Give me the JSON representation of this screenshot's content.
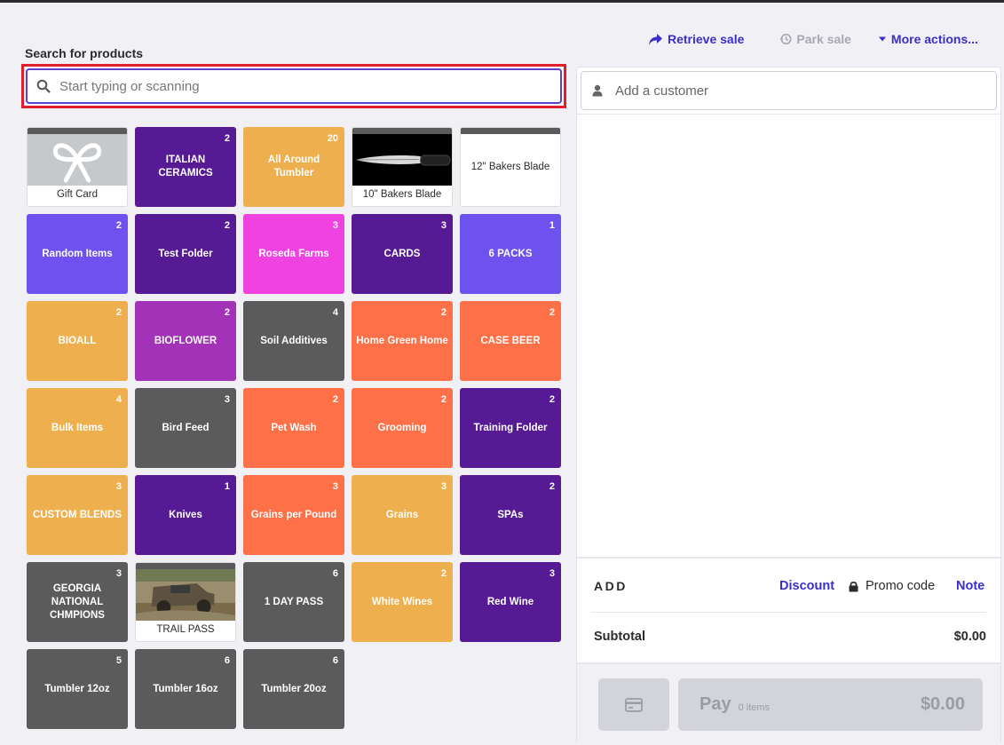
{
  "search": {
    "label": "Search for products",
    "placeholder": "Start typing or scanning"
  },
  "actions": {
    "retrieve": "Retrieve sale",
    "park": "Park sale",
    "more": "More actions..."
  },
  "tiles": [
    {
      "label": "Gift Card",
      "count": "",
      "kind": "image",
      "icon": "gift-bow-image",
      "color": "#c5c9cc"
    },
    {
      "label": "ITALIAN CERAMICS",
      "count": "2",
      "kind": "folder",
      "color": "#561a95"
    },
    {
      "label": "All Around Tumbler",
      "count": "20",
      "kind": "folder",
      "color": "#eeb04e"
    },
    {
      "label": "10\" Bakers Blade",
      "count": "",
      "kind": "image",
      "icon": "knife-image",
      "color": "#000000"
    },
    {
      "label": "12\" Bakers Blade",
      "count": "",
      "kind": "plain",
      "color": "#ffffff"
    },
    {
      "label": "Random Items",
      "count": "2",
      "kind": "folder",
      "color": "#6e52f0"
    },
    {
      "label": "Test Folder",
      "count": "2",
      "kind": "folder",
      "color": "#561a95"
    },
    {
      "label": "Roseda Farms",
      "count": "3",
      "kind": "folder",
      "color": "#f042e0"
    },
    {
      "label": "CARDS",
      "count": "3",
      "kind": "folder",
      "color": "#561a95"
    },
    {
      "label": "6 PACKS",
      "count": "1",
      "kind": "folder",
      "color": "#6e52f0"
    },
    {
      "label": "BIOALL",
      "count": "2",
      "kind": "folder",
      "color": "#eeb04e"
    },
    {
      "label": "BIOFLOWER",
      "count": "2",
      "kind": "folder",
      "color": "#a232b8"
    },
    {
      "label": "Soil Additives",
      "count": "4",
      "kind": "folder",
      "color": "#5b5b5b"
    },
    {
      "label": "Home Green Home",
      "count": "2",
      "kind": "folder",
      "color": "#fe7048"
    },
    {
      "label": "CASE BEER",
      "count": "2",
      "kind": "folder",
      "color": "#fe7048"
    },
    {
      "label": "Bulk Items",
      "count": "4",
      "kind": "folder",
      "color": "#eeb04e"
    },
    {
      "label": "Bird Feed",
      "count": "3",
      "kind": "folder",
      "color": "#5b5b5b"
    },
    {
      "label": "Pet Wash",
      "count": "2",
      "kind": "folder",
      "color": "#fe7048"
    },
    {
      "label": "Grooming",
      "count": "2",
      "kind": "folder",
      "color": "#fe7048"
    },
    {
      "label": "Training Folder",
      "count": "2",
      "kind": "folder",
      "color": "#561a95"
    },
    {
      "label": "CUSTOM BLENDS",
      "count": "3",
      "kind": "folder",
      "color": "#eeb04e"
    },
    {
      "label": "Knives",
      "count": "1",
      "kind": "folder",
      "color": "#561a95"
    },
    {
      "label": "Grains per Pound",
      "count": "3",
      "kind": "folder",
      "color": "#fe7048"
    },
    {
      "label": "Grains",
      "count": "3",
      "kind": "folder",
      "color": "#eeb04e"
    },
    {
      "label": "SPAs",
      "count": "2",
      "kind": "folder",
      "color": "#561a95"
    },
    {
      "label": "GEORGIA NATIONAL CHMPIONS",
      "count": "3",
      "kind": "folder",
      "color": "#5b5b5b"
    },
    {
      "label": "TRAIL PASS",
      "count": "",
      "kind": "image",
      "icon": "mud-truck-image",
      "color": "#8a7a5a"
    },
    {
      "label": "1 DAY PASS",
      "count": "6",
      "kind": "folder",
      "color": "#5b5b5b"
    },
    {
      "label": "White Wines",
      "count": "2",
      "kind": "folder",
      "color": "#eeb04e"
    },
    {
      "label": "Red Wine",
      "count": "3",
      "kind": "folder",
      "color": "#561a95"
    },
    {
      "label": "Tumbler 12oz",
      "count": "5",
      "kind": "folder",
      "color": "#5b5b5b"
    },
    {
      "label": "Tumbler 16oz",
      "count": "6",
      "kind": "folder",
      "color": "#5b5b5b"
    },
    {
      "label": "Tumbler 20oz",
      "count": "6",
      "kind": "folder",
      "color": "#5b5b5b"
    }
  ],
  "customer": {
    "placeholder": "Add a customer"
  },
  "summary": {
    "add_label": "ADD",
    "discount": "Discount",
    "promo": "Promo code",
    "note": "Note",
    "subtotal_label": "Subtotal",
    "subtotal_value": "$0.00"
  },
  "pay": {
    "label": "Pay",
    "items": "0 items",
    "total": "$0.00"
  }
}
